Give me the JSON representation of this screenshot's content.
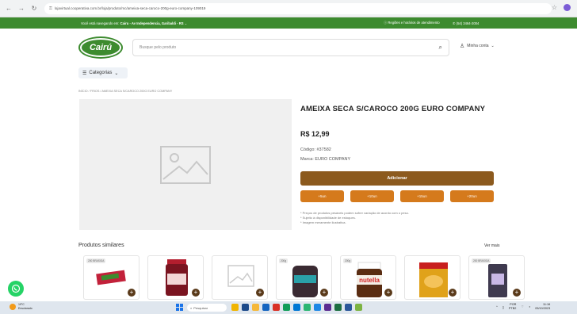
{
  "browser": {
    "url": "lojavirtual.cooperativa.com.br/loja/produto/mc/ameixa-seca-caroco-200g-euro-company-109019"
  },
  "topbar": {
    "location_prefix": "Você está navegando em: ",
    "location_bold": "Cairu - Av Independencia, Garibaldi - RS",
    "help": "Regiões e horários de atendimento",
    "phone": "(54) 3464-2004"
  },
  "header": {
    "logo_text": "Cairú",
    "search_placeholder": "Busque pelo produto",
    "account_label": "Minha conta",
    "categories_label": "Categorias"
  },
  "breadcrumb": "INÍCIO / FRIOS / AMEIXA SECA S/CAROCO 200G EURO COMPANY",
  "product": {
    "title": "AMEIXA SECA S/CAROCO 200G EURO COMPANY",
    "price": "R$ 12,99",
    "code": "Código: #37582",
    "brand": "Marca: EURO COMPANY",
    "add_label": "Adicionar",
    "qty_options": [
      "+5un",
      "+10un",
      "+15un",
      "+20un"
    ],
    "notes": [
      "* Preços de produtos pesáveis podem sofrer variação de acordo com o peso.",
      "* Sujeito à disponibilidade de estoques.",
      "* Imagem meramente ilustrativa."
    ]
  },
  "similar": {
    "title": "Produtos similares",
    "see_more": "Ver mais",
    "items": [
      {
        "tag": "200 BRASIGA",
        "icon": "candy-bar-product"
      },
      {
        "tag": "",
        "icon": "jam-jar-product"
      },
      {
        "tag": "",
        "icon": "placeholder-image"
      },
      {
        "tag": "200g",
        "icon": "jelly-jar-product"
      },
      {
        "tag": "200g",
        "icon": "nutella-jar-product"
      },
      {
        "tag": "",
        "icon": "snack-pack-product"
      },
      {
        "tag": "200 BRASIGA",
        "icon": "bag-product"
      }
    ]
  },
  "taskbar": {
    "weather_temp": "19°C",
    "weather_desc": "Ensolarado",
    "search_label": "Pesquisar",
    "lang": "POR",
    "lang2": "PTB2",
    "time": "11:16",
    "date": "05/10/2023"
  },
  "colors": {
    "green": "#3d8b2f",
    "brown": "#8c5a1e",
    "orange": "#d57a1c"
  }
}
